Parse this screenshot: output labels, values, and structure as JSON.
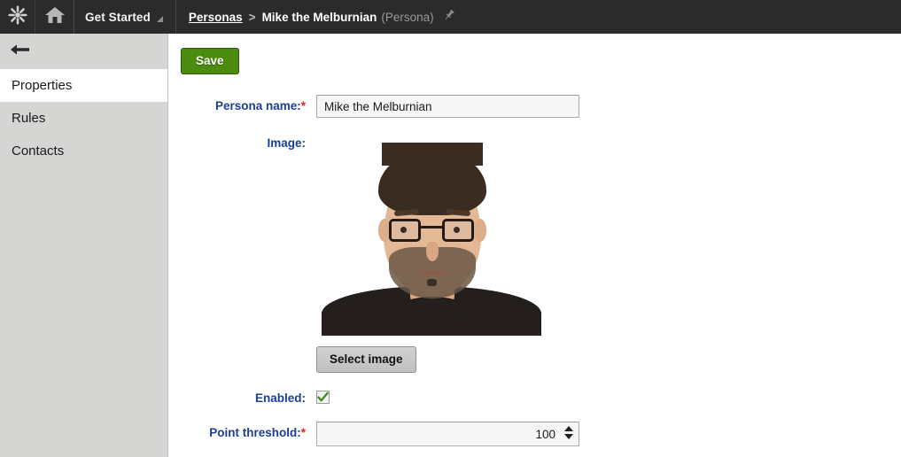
{
  "topbar": {
    "logo_icon": "starburst-icon",
    "home_icon": "home-icon",
    "tab_label": "Get Started",
    "breadcrumb": {
      "parent": "Personas",
      "separator": ">",
      "current": "Mike the Melburnian",
      "type": "(Persona)",
      "pin_icon": "pin-icon"
    }
  },
  "sidebar": {
    "back_icon": "back-arrow-icon",
    "items": [
      {
        "label": "Properties",
        "active": true
      },
      {
        "label": "Rules",
        "active": false
      },
      {
        "label": "Contacts",
        "active": false
      }
    ]
  },
  "toolbar": {
    "save_label": "Save"
  },
  "form": {
    "persona_name": {
      "label": "Persona name:",
      "required_marker": "*",
      "value": "Mike the Melburnian",
      "placeholder": ""
    },
    "image": {
      "label": "Image:",
      "select_button_label": "Select image",
      "alt": "Portrait photo of a bearded man wearing dark-rimmed glasses and a black t-shirt on a white background"
    },
    "enabled": {
      "label": "Enabled:",
      "checked": true,
      "check_glyph": "✔"
    },
    "point_threshold": {
      "label": "Point threshold:",
      "required_marker": "*",
      "value": "100",
      "placeholder": ""
    }
  },
  "colors": {
    "topbar_bg": "#2b2b2b",
    "sidebar_bg": "#d5d6d3",
    "label_blue": "#1b3f94",
    "required_red": "#e02020",
    "save_green": "#4b8b10",
    "check_green": "#3a8a16"
  }
}
